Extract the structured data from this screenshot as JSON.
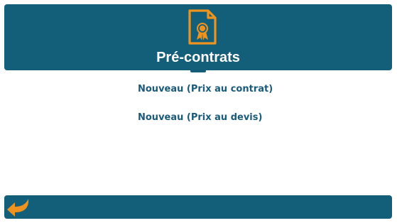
{
  "header": {
    "title": "Pré-contrats",
    "icon": "certificate-document-icon"
  },
  "menu": {
    "items": [
      {
        "label": "Nouveau (Prix au contrat)"
      },
      {
        "label": "Nouveau (Prix au devis)"
      }
    ]
  },
  "footer": {
    "back_icon": "back-arrow-icon"
  },
  "colors": {
    "primary": "#135e79",
    "accent": "#f0931e",
    "link": "#1a5a7a",
    "background": "#ffffff"
  }
}
